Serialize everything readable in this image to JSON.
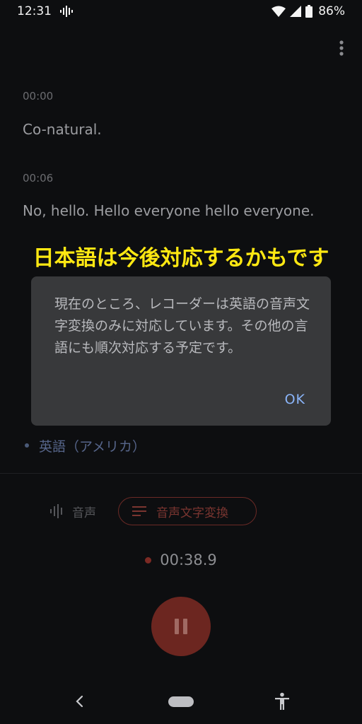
{
  "status_bar": {
    "time": "12:31",
    "battery": "86%"
  },
  "transcript": {
    "entries": [
      {
        "time": "00:00",
        "text": "Co-natural."
      },
      {
        "time": "00:06",
        "text": "No, hello. Hello everyone hello everyone."
      }
    ]
  },
  "annotation": "日本語は今後対応するかもです",
  "dialog": {
    "message": "現在のところ、レコーダーは英語の音声文字変換のみに対応しています。その他の言語にも順次対応する予定です。",
    "ok_label": "OK"
  },
  "language": "英語（アメリカ）",
  "tabs": {
    "audio": "音声",
    "transcript": "音声文字変換"
  },
  "timer": "00:38.9",
  "colors": {
    "accent_red": "#6c2620",
    "annotation_yellow": "#ffe812",
    "dialog_button_blue": "#8ab4f8"
  }
}
